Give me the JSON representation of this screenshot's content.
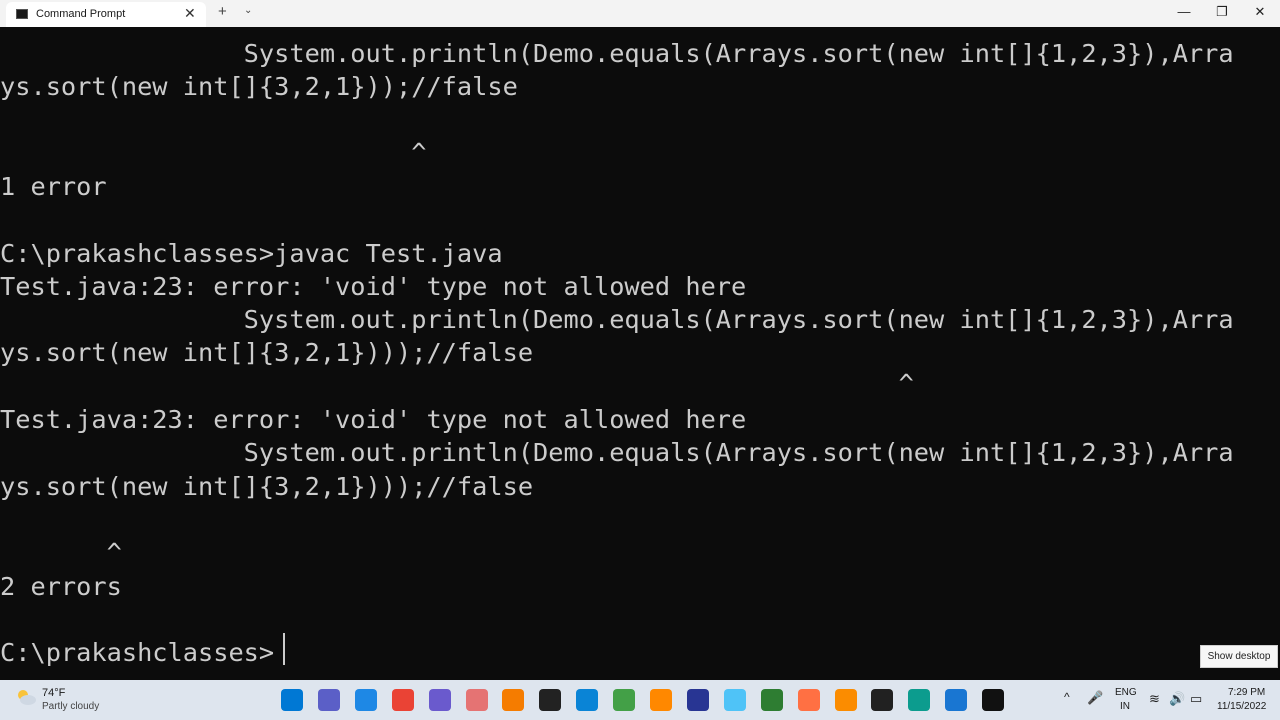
{
  "window": {
    "tab_title": "Command Prompt",
    "tab_close": "✕",
    "new_tab": "+",
    "tab_dropdown": "⌄",
    "minimize": "—",
    "maximize": "❐",
    "close": "✕"
  },
  "terminal": {
    "lines": [
      "                System.out.println(Demo.equals(Arrays.sort(new int[]{1,2,3}),Arra",
      "ys.sort(new int[]{3,2,1}));//false",
      "",
      "                           ^",
      "1 error",
      "",
      "C:\\prakashclasses>javac Test.java",
      "Test.java:23: error: 'void' type not allowed here",
      "                System.out.println(Demo.equals(Arrays.sort(new int[]{1,2,3}),Arra",
      "ys.sort(new int[]{3,2,1})));//false",
      "                                                           ^",
      "Test.java:23: error: 'void' type not allowed here",
      "                System.out.println(Demo.equals(Arrays.sort(new int[]{1,2,3}),Arra",
      "ys.sort(new int[]{3,2,1})));//false",
      "",
      "       ^",
      "2 errors",
      "",
      "C:\\prakashclasses>"
    ]
  },
  "tooltip": {
    "show_desktop": "Show desktop"
  },
  "taskbar": {
    "weather_temp": "74°F",
    "weather_desc": "Partly cloudy",
    "apps": [
      {
        "name": "start-icon",
        "color": "#0078d4"
      },
      {
        "name": "teams-chat-icon",
        "color": "#5b5fc7"
      },
      {
        "name": "desktop-icon",
        "color": "#1e88e5"
      },
      {
        "name": "chrome-icon",
        "color": "#ea4335"
      },
      {
        "name": "zoom-icon",
        "color": "#6a5acd"
      },
      {
        "name": "paint-icon",
        "color": "#e57373"
      },
      {
        "name": "sublime-text-icon",
        "color": "#f57c00"
      },
      {
        "name": "terminal-icon",
        "color": "#222222"
      },
      {
        "name": "vscode-icon",
        "color": "#0a84d6"
      },
      {
        "name": "globe-icon",
        "color": "#43a047"
      },
      {
        "name": "vlc-icon",
        "color": "#ff8800"
      },
      {
        "name": "media-icon",
        "color": "#283593"
      },
      {
        "name": "notepad-icon",
        "color": "#4fc3f7"
      },
      {
        "name": "xbox-icon",
        "color": "#2e7d32"
      },
      {
        "name": "firefox-icon",
        "color": "#ff7043"
      },
      {
        "name": "settings-flower-icon",
        "color": "#fb8c00"
      },
      {
        "name": "obs-icon",
        "color": "#212121"
      },
      {
        "name": "edge-icon",
        "color": "#0c9c8e"
      },
      {
        "name": "photos-icon",
        "color": "#1976d2"
      },
      {
        "name": "command-prompt-icon",
        "color": "#111111"
      }
    ],
    "tray_chevron": "^",
    "tray_mic": "🎤",
    "lang_1": "ENG",
    "lang_2": "IN",
    "tray_wifi": "≋",
    "tray_volume": "🔊",
    "tray_battery": "▭",
    "time": "7:29 PM",
    "date": "11/15/2022"
  }
}
